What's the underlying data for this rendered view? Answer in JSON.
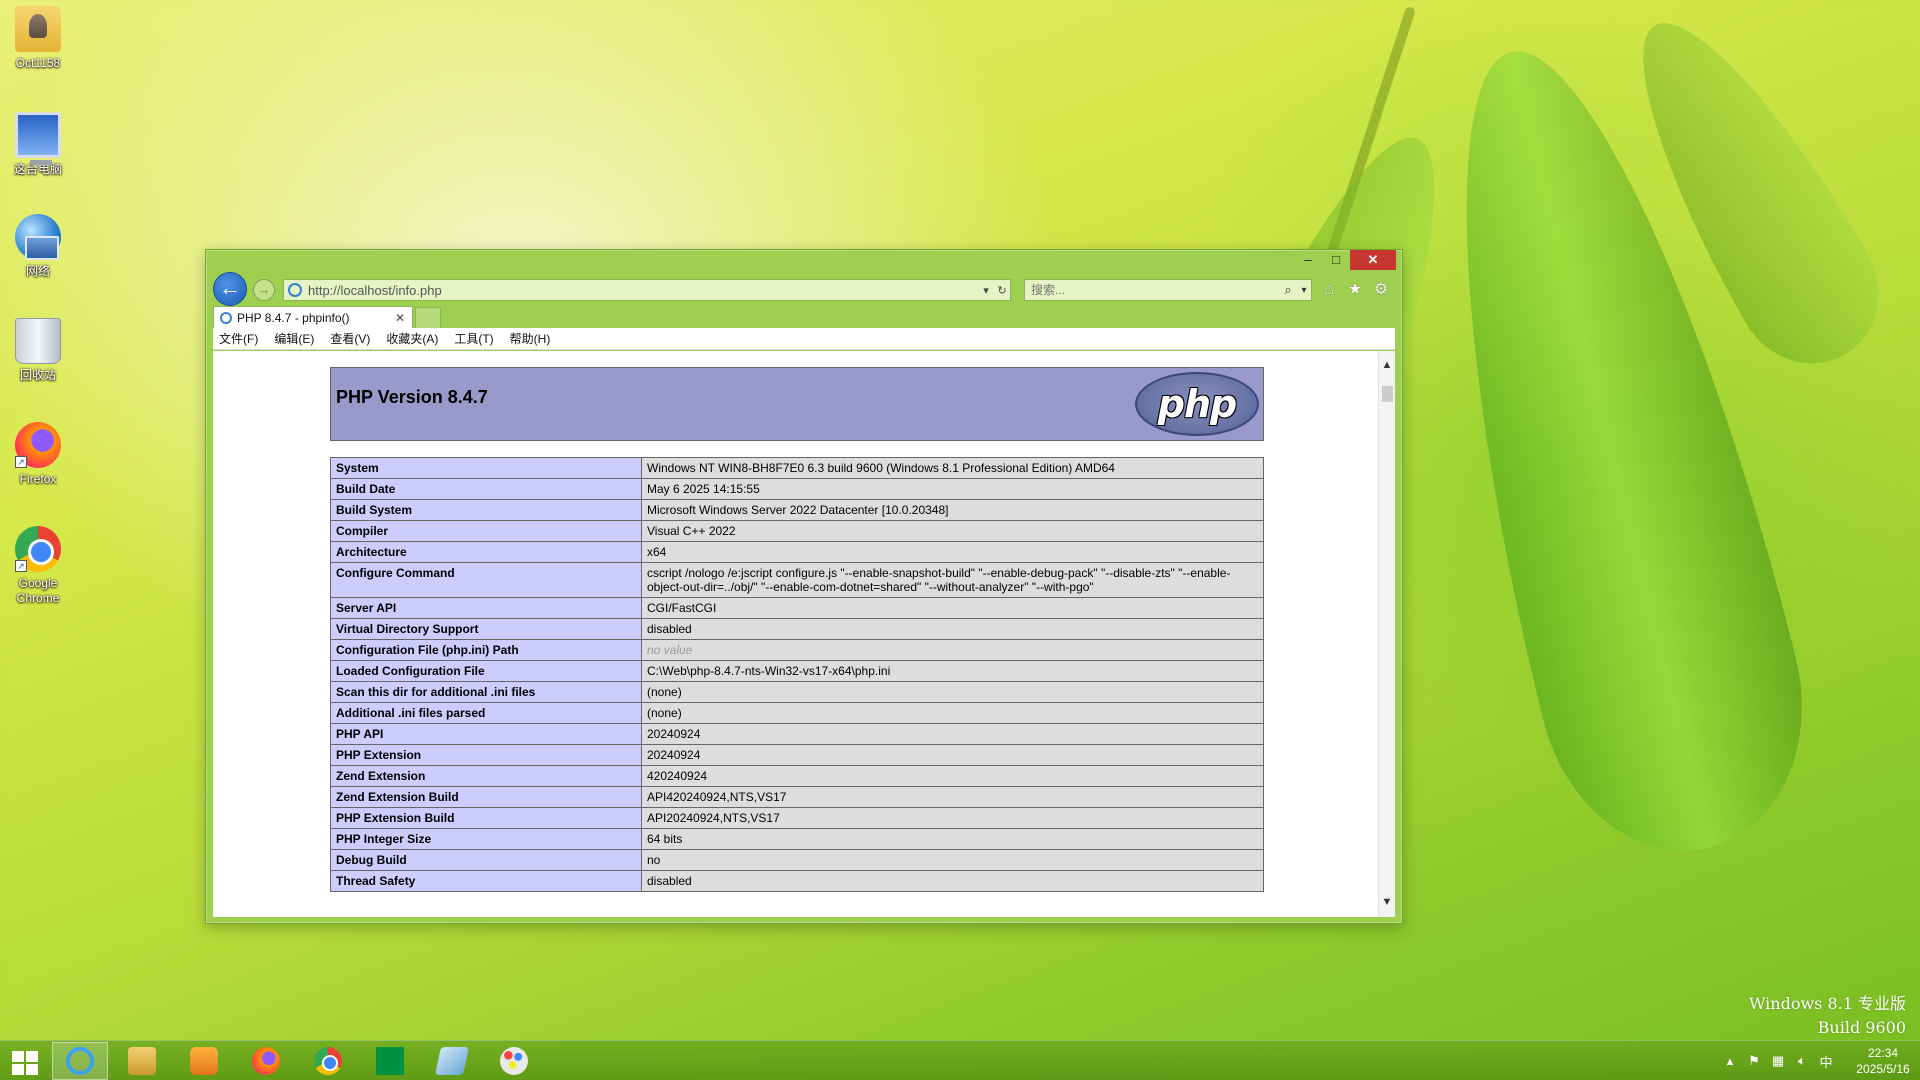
{
  "desktop": {
    "icons": [
      {
        "label": "Oct1158"
      },
      {
        "label": "这台电脑"
      },
      {
        "label": "网络"
      },
      {
        "label": "回收站"
      },
      {
        "label": "Firefox"
      },
      {
        "label": "Google Chrome"
      }
    ],
    "watermark": {
      "line1": "Windows 8.1 专业版",
      "line2": "Build 9600"
    }
  },
  "browser": {
    "window_controls": {
      "minimize": "–",
      "maximize": "□",
      "close": "✕"
    },
    "address": "http://localhost/info.php",
    "search_placeholder": "搜索...",
    "tab": {
      "title": "PHP 8.4.7 - phpinfo()",
      "close": "✕"
    },
    "menu": [
      "文件(F)",
      "编辑(E)",
      "查看(V)",
      "收藏夹(A)",
      "工具(T)",
      "帮助(H)"
    ],
    "icons": [
      "back-icon",
      "forward-icon",
      "refresh-icon",
      "search-icon",
      "home-icon",
      "favorites-icon",
      "settings-icon"
    ]
  },
  "phpinfo": {
    "title": "PHP Version 8.4.7",
    "logo_text": "php",
    "rows": [
      {
        "key": "System",
        "value": "Windows NT WIN8-BH8F7E0 6.3 build 9600 (Windows 8.1 Professional Edition) AMD64"
      },
      {
        "key": "Build Date",
        "value": "May 6 2025 14:15:55"
      },
      {
        "key": "Build System",
        "value": "Microsoft Windows Server 2022 Datacenter [10.0.20348]"
      },
      {
        "key": "Compiler",
        "value": "Visual C++ 2022"
      },
      {
        "key": "Architecture",
        "value": "x64"
      },
      {
        "key": "Configure Command",
        "value": "cscript /nologo /e:jscript configure.js \"--enable-snapshot-build\" \"--enable-debug-pack\" \"--disable-zts\" \"--enable-object-out-dir=../obj/\" \"--enable-com-dotnet=shared\" \"--without-analyzer\" \"--with-pgo\""
      },
      {
        "key": "Server API",
        "value": "CGI/FastCGI"
      },
      {
        "key": "Virtual Directory Support",
        "value": "disabled"
      },
      {
        "key": "Configuration File (php.ini) Path",
        "value": "no value"
      },
      {
        "key": "Loaded Configuration File",
        "value": "C:\\Web\\php-8.4.7-nts-Win32-vs17-x64\\php.ini"
      },
      {
        "key": "Scan this dir for additional .ini files",
        "value": "(none)"
      },
      {
        "key": "Additional .ini files parsed",
        "value": "(none)"
      },
      {
        "key": "PHP API",
        "value": "20240924"
      },
      {
        "key": "PHP Extension",
        "value": "20240924"
      },
      {
        "key": "Zend Extension",
        "value": "420240924"
      },
      {
        "key": "Zend Extension Build",
        "value": "API420240924,NTS,VS17"
      },
      {
        "key": "PHP Extension Build",
        "value": "API20240924,NTS,VS17"
      },
      {
        "key": "PHP Integer Size",
        "value": "64 bits"
      },
      {
        "key": "Debug Build",
        "value": "no"
      },
      {
        "key": "Thread Safety",
        "value": "disabled"
      }
    ]
  },
  "taskbar": {
    "apps": [
      "Internet Explorer",
      "File Explorer",
      "Media Player",
      "Firefox",
      "Google Chrome",
      "Store",
      "Notepad",
      "Paint"
    ],
    "active_app": "Internet Explorer",
    "tray": {
      "ime": "中",
      "time": "22:34",
      "date": "2025/5/16"
    }
  }
}
